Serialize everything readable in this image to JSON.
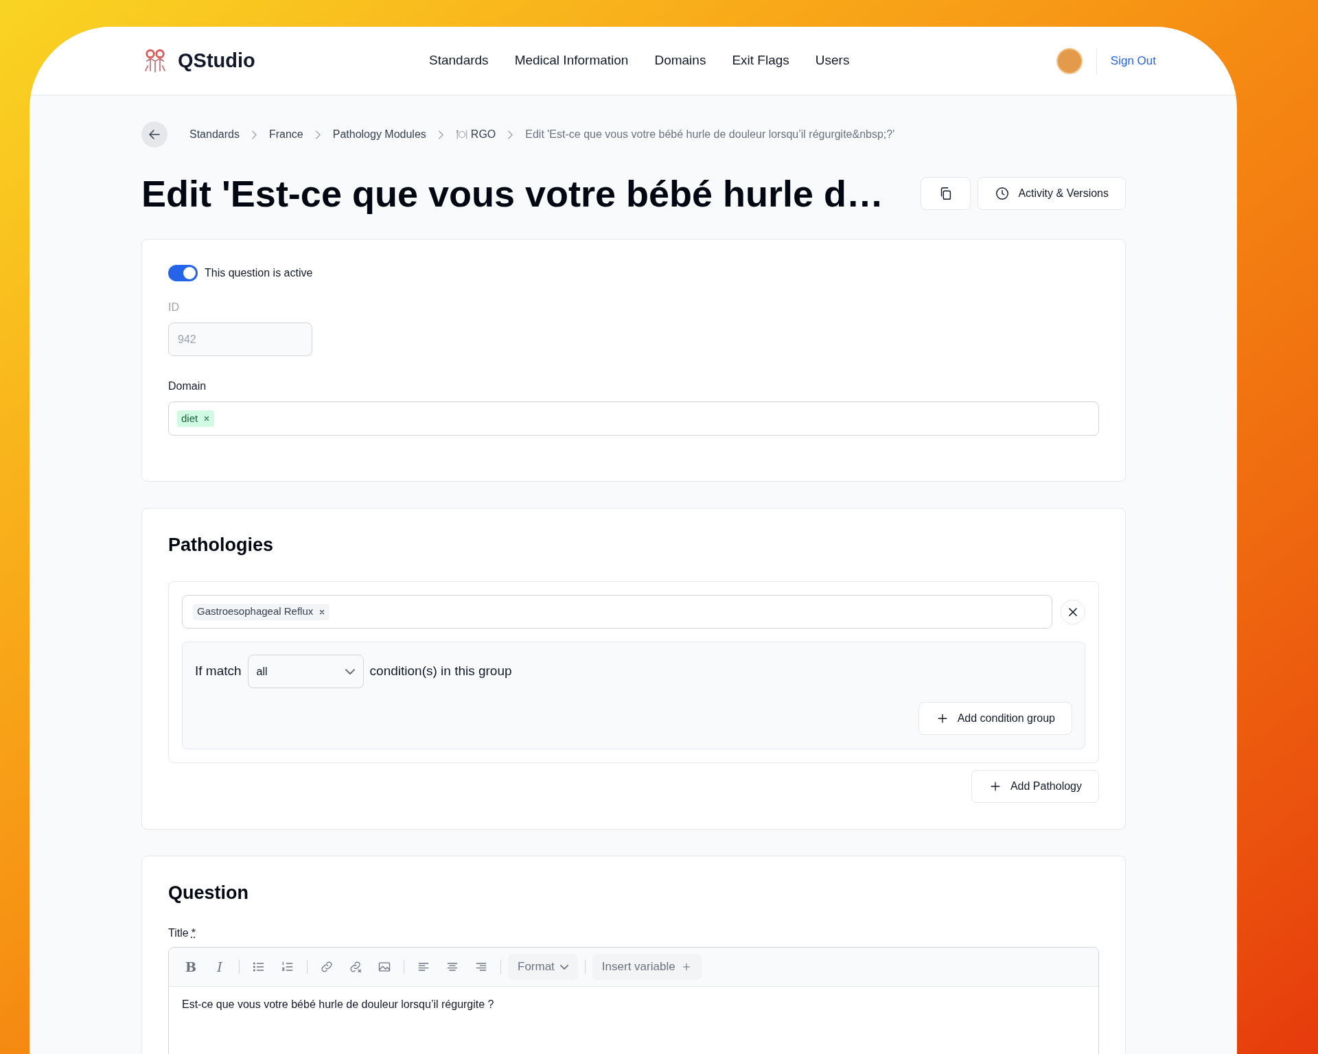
{
  "header": {
    "brand": "QStudio",
    "nav": [
      {
        "label": "Standards"
      },
      {
        "label": "Medical Information"
      },
      {
        "label": "Domains"
      },
      {
        "label": "Exit Flags"
      },
      {
        "label": "Users"
      }
    ],
    "sign_out": "Sign Out"
  },
  "breadcrumb": [
    {
      "label": "Standards",
      "kind": "link"
    },
    {
      "label": "France",
      "kind": "link"
    },
    {
      "label": "Pathology Modules",
      "kind": "link"
    },
    {
      "label": "RGO",
      "kind": "module"
    },
    {
      "label": "Edit 'Est-ce que vous votre bébé hurle de douleur lorsqu’il régurgite&nbsp;?'",
      "kind": "current"
    }
  ],
  "page_title": "Edit 'Est-ce que vous votre bébé hurle d…",
  "activity_button": "Activity & Versions",
  "active_toggle": {
    "label": "This question is active",
    "on": true
  },
  "id_field": {
    "label": "ID",
    "value": "942",
    "disabled": true
  },
  "domain_field": {
    "label": "Domain",
    "tags": [
      {
        "label": "diet"
      }
    ]
  },
  "pathologies": {
    "heading": "Pathologies",
    "groups": [
      {
        "tags": [
          {
            "label": "Gastroesophageal Reflux"
          }
        ],
        "match_prefix": "If match",
        "match_value": "all",
        "match_suffix": "condition(s) in this group",
        "add_condition": "Add condition group"
      }
    ],
    "add_button": "Add Pathology"
  },
  "question": {
    "heading": "Question",
    "title_label": "Title",
    "required_mark": "*",
    "bold_label": "B",
    "italic_label": "I",
    "format": "Format",
    "insert_variable": "Insert variable",
    "text": "Est-ce que vous votre bébé hurle de douleur lorsqu’il régurgite ?"
  }
}
